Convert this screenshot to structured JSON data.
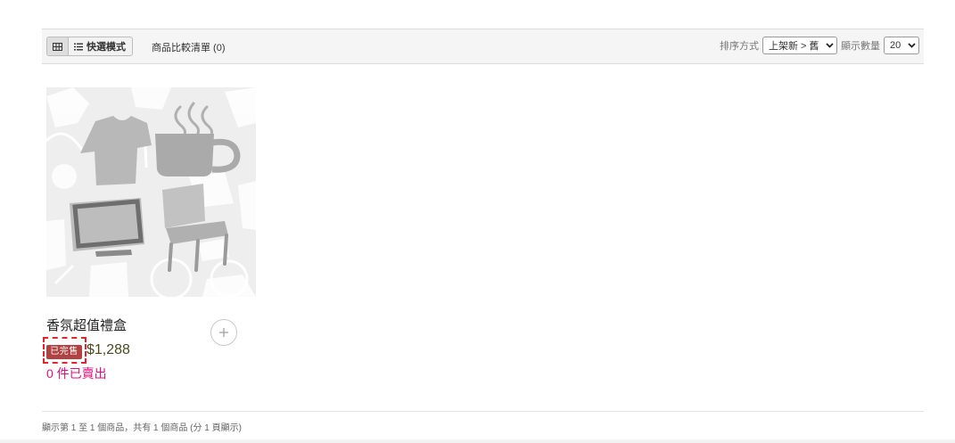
{
  "toolbar": {
    "quick_mode_label": "快選模式",
    "compare_label": "商品比較清單 (0)",
    "sort_label": "排序方式",
    "sort_value": "上架新 > 舊",
    "count_label": "顯示數量",
    "count_value": "20",
    "icons": [
      "grid-icon",
      "list-icon",
      "chevron-down-icon"
    ]
  },
  "product": {
    "name": "香氛超值禮盒",
    "soldout_badge": "已完售",
    "price": "$1,288",
    "sold_count": "0 件已賣出",
    "image_icon": "product-placeholder-icon",
    "compare_icon": "plus-icon"
  },
  "footer": {
    "summary": "顯示第 1 至 1 個商品，共有 1 個商品 (分 1 頁顯示)"
  },
  "colors": {
    "accent_pink": "#e0117c",
    "badge_red": "#b04242",
    "highlight_red": "#e0262b",
    "price": "#4a4a1e"
  }
}
